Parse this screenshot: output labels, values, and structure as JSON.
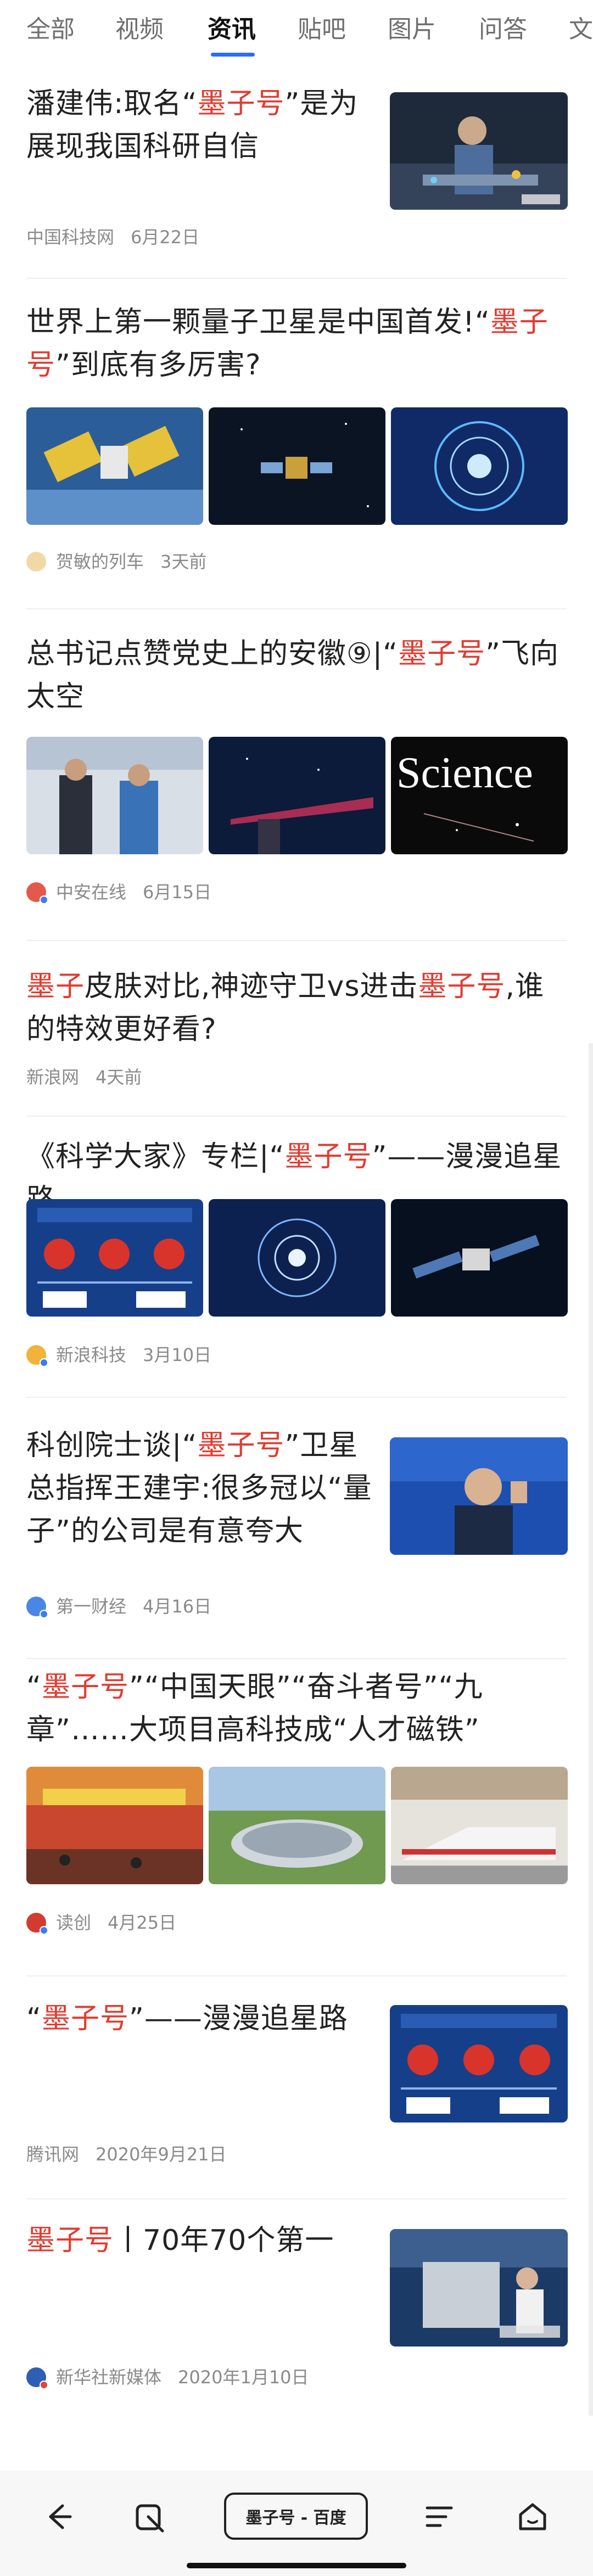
{
  "tabs": [
    {
      "label": "全部"
    },
    {
      "label": "视频"
    },
    {
      "label": "资讯"
    },
    {
      "label": "贴吧"
    },
    {
      "label": "图片"
    },
    {
      "label": "问答"
    },
    {
      "label": "文"
    }
  ],
  "active_tab": "资讯",
  "colors": {
    "highlight": "#e33b2f",
    "accent": "#2d6bf5"
  },
  "articles": [
    {
      "t1": "潘建伟:取名“",
      "hl1": "墨子号",
      "t2": "”是为展现我国科研自信",
      "source": "中国科技网",
      "date": "6月22日"
    },
    {
      "t1": "世界上第一颗量子卫星是中国首发!“",
      "hl1": "墨子号",
      "t2": "”到底有多厉害?",
      "source": "贺敏的列车",
      "date": "3天前"
    },
    {
      "t1": "总书记点赞党史上的安徽⑨|“",
      "hl1": "墨子号",
      "t2": "”飞向太空",
      "source": "中安在线",
      "date": "6月15日",
      "science_label": "Science"
    },
    {
      "hl1": "墨子",
      "t1": "皮肤对比,神迹守卫vs进击",
      "hl2": "墨子号",
      "t2": ",谁的特效更好看?",
      "source": "新浪网",
      "date": "4天前"
    },
    {
      "t1": "《科学大家》专栏|“",
      "hl1": "墨子号",
      "t2": "”——漫漫追星路",
      "source": "新浪科技",
      "date": "3月10日"
    },
    {
      "t1": "科创院士谈|“",
      "hl1": "墨子号",
      "t2": "”卫星总指挥王建宇:很多冠以“量子”的公司是有意夸大",
      "source": "第一财经",
      "date": "4月16日"
    },
    {
      "t1": "“",
      "hl1": "墨子号",
      "t2": "”“中国天眼”“奋斗者号”“九章”……大项目高科技成“人才磁铁”",
      "source": "读创",
      "date": "4月25日"
    },
    {
      "t1": "“",
      "hl1": "墨子号",
      "t2": "”——漫漫追星路",
      "source": "腾讯网",
      "date": "2020年9月21日"
    },
    {
      "hl1": "墨子号",
      "t2": "丨70年70个第一",
      "source": "新华社新媒体",
      "date": "2020年1月10日"
    }
  ],
  "bottom_bar": {
    "search_pill": "墨子号 - 百度"
  }
}
